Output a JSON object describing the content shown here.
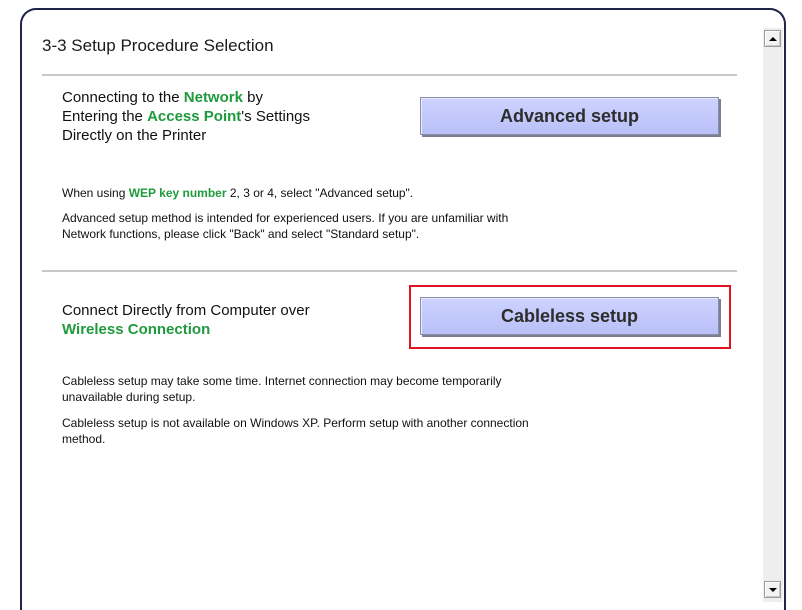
{
  "title": "3-3 Setup Procedure Selection",
  "section1": {
    "heading_part1": "Connecting to the ",
    "heading_highlight1": "Network",
    "heading_part2": " by",
    "heading_part3": "Entering the ",
    "heading_highlight2": "Access Point",
    "heading_part4": "'s Settings",
    "heading_part5": "Directly on the Printer",
    "button_label": "Advanced setup",
    "note1_part1": "When using ",
    "note1_highlight": "WEP key number",
    "note1_part2": " 2, 3 or 4, select \"Advanced setup\".",
    "note2_line1": "Advanced setup method is intended for experienced users. If you are unfamiliar with",
    "note2_line2": "Network functions, please click \"Back\" and select \"Standard setup\"."
  },
  "section2": {
    "heading_line1": "Connect Directly from Computer over",
    "heading_highlight": "Wireless Connection",
    "button_label": "Cableless setup",
    "note1_line1": "Cableless setup may take some time. Internet connection may become temporarily",
    "note1_line2": "unavailable during setup.",
    "note2_line1": "Cableless setup is not available on Windows XP. Perform setup with another connection",
    "note2_line2": "method."
  },
  "colors": {
    "highlight_green": "#1f9a3c",
    "button_fill": "#b9c0f7",
    "selection_box": "#e0141e",
    "frame_border": "#1f2548"
  },
  "icons": {
    "scroll_up": "scroll-up-arrow-icon",
    "scroll_down": "scroll-down-arrow-icon"
  }
}
